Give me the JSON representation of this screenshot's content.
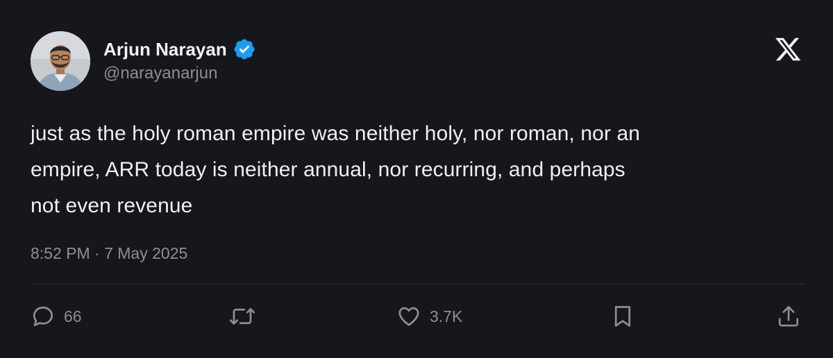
{
  "author": {
    "name": "Arjun Narayan",
    "handle": "@narayanarjun",
    "verified": true
  },
  "tweet": {
    "lines": [
      "just as the holy roman empire was neither holy, nor roman, nor an",
      "empire, ARR today is neither annual, nor recurring, and perhaps",
      "not even revenue"
    ],
    "timestamp": "8:52 PM · 7 May 2025"
  },
  "actions": {
    "replies": "66",
    "likes": "3.7K"
  },
  "icons": {
    "verified": "verified-badge-icon",
    "brand": "x-logo-icon",
    "reply": "reply-icon",
    "retweet": "retweet-icon",
    "like": "heart-icon",
    "bookmark": "bookmark-icon",
    "share": "share-icon"
  },
  "colors": {
    "background": "#16171c",
    "text": "#e7e9ea",
    "muted": "#8b9096",
    "verified": "#1d9bf0",
    "divider": "#2b2d33"
  }
}
